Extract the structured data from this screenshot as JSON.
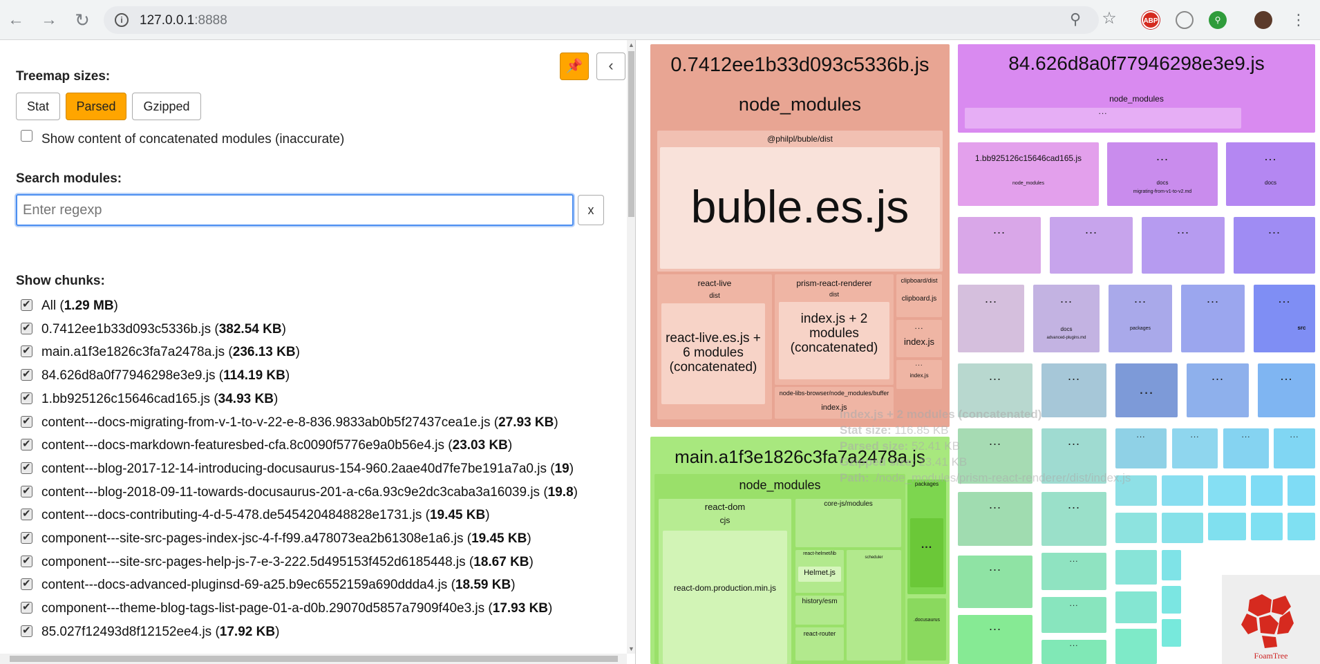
{
  "browser": {
    "url_host": "127.0.0.1",
    "url_port": ":8888",
    "back_icon": "arrow-left-icon",
    "forward_icon": "arrow-right-icon",
    "reload_icon": "reload-icon",
    "abp_label": "ABP"
  },
  "sidebar": {
    "treemap_sizes_title": "Treemap sizes:",
    "size_buttons": [
      "Stat",
      "Parsed",
      "Gzipped"
    ],
    "active_size": "Parsed",
    "concat_label": "Show content of concatenated modules (inaccurate)",
    "search_title": "Search modules:",
    "search_placeholder": "Enter regexp",
    "clear_label": "x",
    "show_chunks_title": "Show chunks:",
    "chunks": [
      {
        "name": "All",
        "size": "1.29 MB"
      },
      {
        "name": "0.7412ee1b33d093c5336b.js",
        "size": "382.54 KB"
      },
      {
        "name": "main.a1f3e1826c3fa7a2478a.js",
        "size": "236.13 KB"
      },
      {
        "name": "84.626d8a0f77946298e3e9.js",
        "size": "114.19 KB"
      },
      {
        "name": "1.bb925126c15646cad165.js",
        "size": "34.93 KB"
      },
      {
        "name": "content---docs-migrating-from-v-1-to-v-22-e-8-836.9833ab0b5f27437cea1e.js",
        "size": "27.93 KB"
      },
      {
        "name": "content---docs-markdown-featuresbed-cfa.8c0090f5776e9a0b56e4.js",
        "size": "23.03 KB"
      },
      {
        "name": "content---blog-2017-12-14-introducing-docusaurus-154-960.2aae40d7fe7be191a7a0.js",
        "size": "19"
      },
      {
        "name": "content---blog-2018-09-11-towards-docusaurus-201-a-c6a.93c9e2dc3caba3a16039.js",
        "size": "19.8"
      },
      {
        "name": "content---docs-contributing-4-d-5-478.de5454204848828e1731.js",
        "size": "19.45 KB"
      },
      {
        "name": "component---site-src-pages-index-jsc-4-f-f99.a478073ea2b61308e1a6.js",
        "size": "19.45 KB"
      },
      {
        "name": "component---site-src-pages-help-js-7-e-3-222.5d495153f452d6185448.js",
        "size": "18.67 KB"
      },
      {
        "name": "content---docs-advanced-pluginsd-69-a25.b9ec6552159a690ddda4.js",
        "size": "18.59 KB"
      },
      {
        "name": "component---theme-blog-tags-list-page-01-a-d0b.29070d5857a7909f40e3.js",
        "size": "17.93 KB"
      },
      {
        "name": "85.027f12493d8f12152ee4.js",
        "size": "17.92 KB"
      }
    ]
  },
  "treemap": {
    "chunk_a": {
      "title": "0.7412ee1b33d093c5336b.js",
      "node_modules": "node_modules",
      "philpl": "@philpl/buble/dist",
      "buble": "buble.es.js",
      "react_live": "react-live",
      "dist": "dist",
      "react_live_es": "react-live.es.js + 6 modules (concatenated)",
      "prism": "prism-react-renderer",
      "prism_dist": "dist",
      "prism_index": "index.js + 2 modules (concatenated)",
      "clipboard_dist": "clipboard/dist",
      "clipboard_js": "clipboard.js",
      "index_js": "index.js",
      "node_libs": "node-libs-browser/node_modules/buffer",
      "buffer_index": "index.js",
      "small_index": "index.js"
    },
    "chunk_b": {
      "title": "84.626d8a0f77946298e3e9.js",
      "node_modules": "node_modules"
    },
    "chunk_c": {
      "title": "1.bb925126c15646cad165.js",
      "node_modules": "node_modules"
    },
    "chunk_main": {
      "title": "main.a1f3e1826c3fa7a2478a.js",
      "node_modules": "node_modules",
      "react_dom": "react-dom",
      "cjs": "cjs",
      "react_dom_prod": "react-dom.production.min.js",
      "core_js": "core-js/modules",
      "react_helmet": "react-helmet/lib",
      "helmet": "Helmet.js",
      "history": "history/esm",
      "react_router": "react-router",
      "packages": "packages",
      "docusaurus": ".docusaurus",
      "scheduler": "scheduler"
    },
    "docs_label": "docs",
    "migrating_label": "migrating-from-v1-to-v2.md",
    "advanced_label": "advanced-plugins.md",
    "packages_label": "packages",
    "src_label": "src",
    "dots": "...",
    "foamtree": "FoamTree"
  },
  "tooltip": {
    "title": "index.js + 2 modules (concatenated)",
    "stat_label": "Stat size:",
    "stat_value": "116.85 KB",
    "parsed_label": "Parsed size:",
    "parsed_value": "52.41 KB",
    "gzipped_label": "Gzipped size:",
    "gzipped_value": "23.41 KB",
    "path_label": "Path:",
    "path_value": "./node_modules/prism-react-renderer/dist/index.js"
  },
  "colors": {
    "accent": "#ffa500",
    "chunk_a": "#e8a593",
    "chunk_b": "#d98af0",
    "chunk_main": "#a8e87e",
    "focus": "#4b8ef1"
  }
}
